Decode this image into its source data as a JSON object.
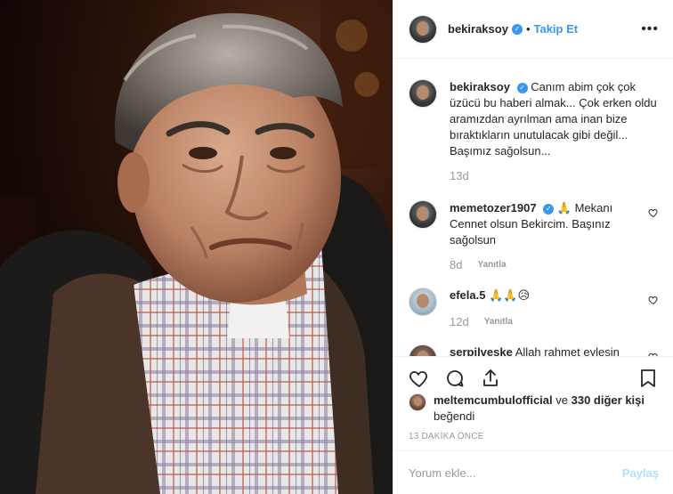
{
  "post": {
    "author": "bekiraksoy",
    "follow_label": "Takip Et",
    "separator": "•",
    "more_icon": "more-options-icon",
    "caption_user": "bekiraksoy",
    "caption_text": "Canım abim çok çok üzücü bu haberi almak... Çok erken oldu aramızdan ayrılman ama inan bize bıraktıkların unutulacak gibi değil... Başımız sağolsun...",
    "caption_age": "13d"
  },
  "comments": [
    {
      "user": "memetozer1907",
      "verified": true,
      "text": "🙏 Mekanı Cennet olsun Bekircim. Başınız sağolsun",
      "age": "8d",
      "reply_label": "Yanıtla"
    },
    {
      "user": "efela.5",
      "verified": false,
      "text": "🙏🙏😥",
      "age": "12d",
      "reply_label": "Yanıtla"
    },
    {
      "user": "serpilveske",
      "verified": false,
      "text": "Allah rahmet eylesin",
      "age": "",
      "reply_label": ""
    }
  ],
  "likes": {
    "user": "meltemcumbulofficial",
    "connector": "ve",
    "others": "330 diğer kişi",
    "suffix": "beğendi"
  },
  "timestamp": "13 DAKİKA ÖNCE",
  "add_comment": {
    "placeholder": "Yorum ekle...",
    "post_label": "Paylaş"
  },
  "colors": {
    "accent": "#3897f0",
    "post_disabled": "#b2dffc",
    "meta": "#999999",
    "border": "#efefef"
  }
}
